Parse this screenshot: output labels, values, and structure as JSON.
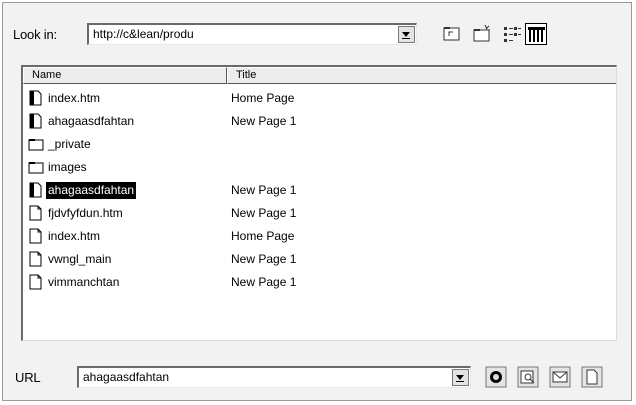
{
  "look_in": {
    "label": "Look in:",
    "value": "http://c&lean/produ"
  },
  "columns": {
    "name": "Name",
    "title": "Title"
  },
  "files": [
    {
      "name": "index.htm",
      "title": "Home Page",
      "icon": "page-icon-dark"
    },
    {
      "name": "ahagaasdfahtan",
      "title": "New Page 1",
      "icon": "page-icon-dark"
    },
    {
      "name": "_private",
      "title": "",
      "icon": "folder-icon"
    },
    {
      "name": "images",
      "title": "",
      "icon": "folder-icon"
    },
    {
      "name": "ahagaasdfahtan",
      "title": "New Page 1",
      "icon": "page-icon-dark"
    },
    {
      "name": "fjdvfyfdun.htm",
      "title": "New Page 1",
      "icon": "page-icon"
    },
    {
      "name": "index.htm",
      "title": "Home Page",
      "icon": "page-icon"
    },
    {
      "name": "vwngl_main",
      "title": "New Page 1",
      "icon": "page-icon"
    },
    {
      "name": "vimmanchtan",
      "title": "New Page 1",
      "icon": "page-icon"
    }
  ],
  "selected_index": 4,
  "url": {
    "label": "URL",
    "value": "ahagaasdfahtan"
  },
  "toolbar_icons": [
    "up-folder-icon",
    "new-folder-icon",
    "list-view-icon",
    "details-view-icon"
  ],
  "url_icons": [
    "browse-web-icon",
    "browse-folder-icon",
    "email-icon",
    "new-page-icon"
  ]
}
